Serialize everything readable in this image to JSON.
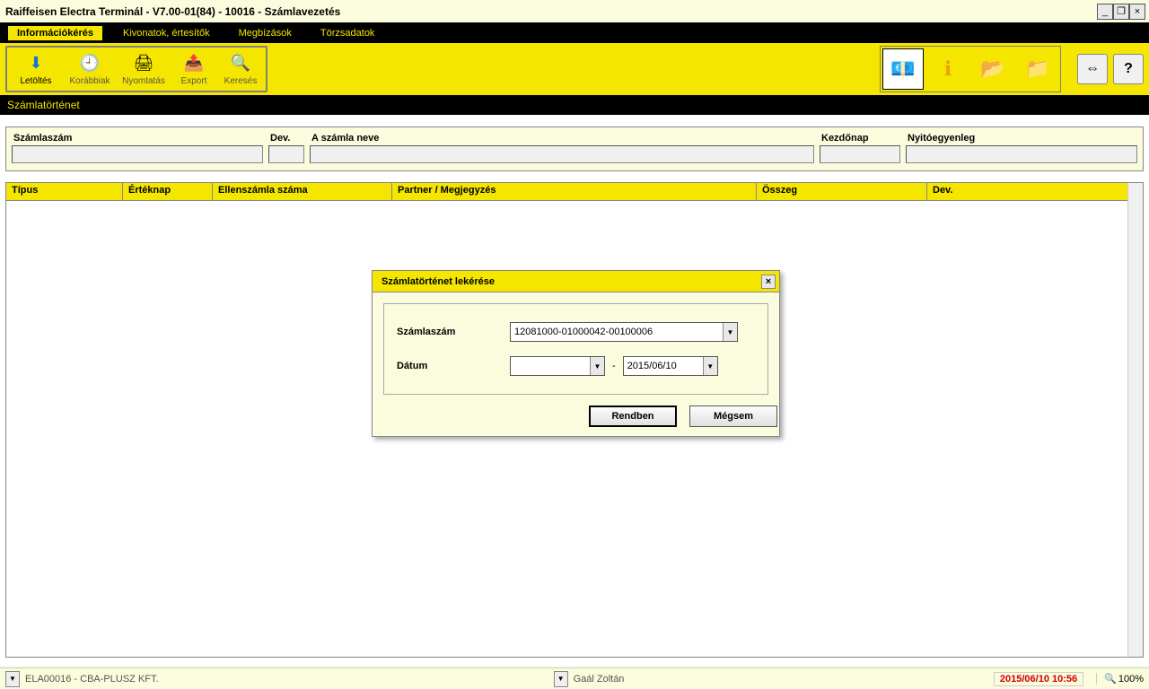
{
  "titlebar": {
    "text": "Raiffeisen Electra Terminál - V7.00-01(84) - 10016 - Számlavezetés"
  },
  "menu": {
    "items": [
      "Információkérés",
      "Kivonatok, értesítők",
      "Megbízások",
      "Törzsadatok"
    ],
    "active_index": 0
  },
  "toolbar": {
    "download": "Letöltés",
    "earlier": "Korábbiak",
    "print": "Nyomtatás",
    "export": "Export",
    "search": "Keresés"
  },
  "subheader": "Számlatörténet",
  "filter": {
    "account_no_label": "Számlaszám",
    "currency_label": "Dev.",
    "account_name_label": "A számla neve",
    "start_date_label": "Kezdőnap",
    "opening_balance_label": "Nyitóegyenleg",
    "account_no": "",
    "currency": "",
    "account_name": "",
    "start_date": "",
    "opening_balance": ""
  },
  "table_headers": [
    "Típus",
    "Értéknap",
    "Ellenszámla száma",
    "Partner / Megjegyzés",
    "Összeg",
    "Dev."
  ],
  "modal": {
    "title": "Számlatörténet lekérése",
    "account_label": "Számlaszám",
    "date_label": "Dátum",
    "account_value": "12081000-01000042-00100006",
    "date_from": "",
    "date_to": "2015/06/10",
    "ok_label": "Rendben",
    "cancel_label": "Mégsem"
  },
  "statusbar": {
    "company": "ELA00016 - CBA-PLUSZ KFT.",
    "user": "Gaál Zoltán",
    "datetime": "2015/06/10 10:56",
    "zoom": "100%"
  }
}
